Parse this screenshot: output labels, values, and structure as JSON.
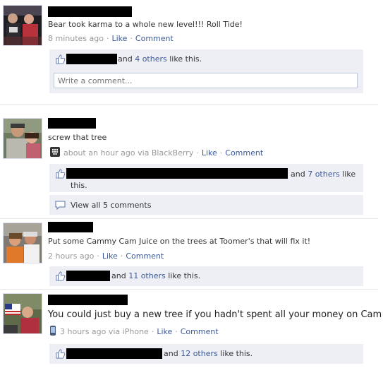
{
  "posts": [
    {
      "message": "Bear took karma to a whole new level!!! Roll Tide!",
      "time": "8 minutes ago",
      "like_label": "Like",
      "comment_label": "Comment",
      "likes_text_before": "and ",
      "likes_others_link": "4 others",
      "likes_text_after": " like this.",
      "comment_placeholder": "Write a comment..."
    },
    {
      "message": "screw that tree",
      "time": "about an hour ago via BlackBerry",
      "like_label": "Like",
      "comment_label": "Comment",
      "likes_text_before": "and ",
      "likes_others_link": "7 others",
      "likes_text_after": " like",
      "likes_text_wrap": "this.",
      "view_comments": "View all 5 comments"
    },
    {
      "message": "Put some Cammy Cam Juice on the trees at Toomer's that will fix it!",
      "time": "2 hours ago",
      "like_label": "Like",
      "comment_label": "Comment",
      "likes_text_before": "and ",
      "likes_others_link": "11 others",
      "likes_text_after": " like this."
    },
    {
      "message": "You could just buy a new tree if you hadn't spent all your money on Cam",
      "time": "3 hours ago via iPhone",
      "like_label": "Like",
      "comment_label": "Comment",
      "likes_text_before": "and ",
      "likes_others_link": "12 others",
      "likes_text_after": " like this."
    }
  ],
  "colors": {
    "link": "#3b5998",
    "meta": "#999999",
    "box_background": "#edeff4",
    "redaction": "#000000"
  }
}
